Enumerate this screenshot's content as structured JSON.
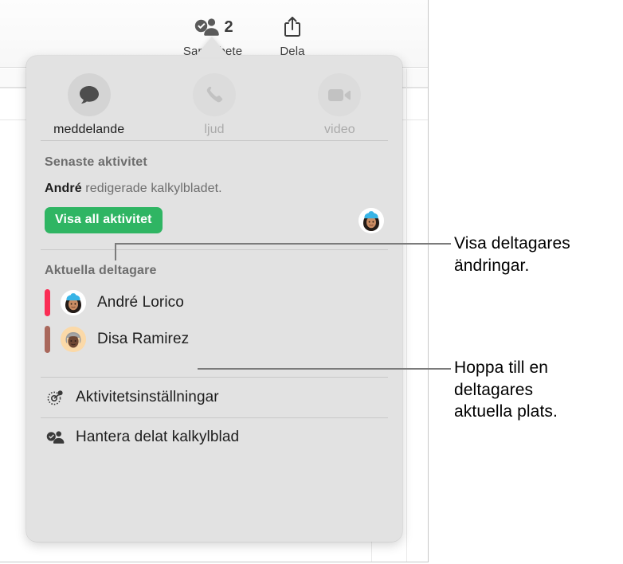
{
  "window": {
    "toolbar": {
      "items": [
        {
          "label": "Samarbete",
          "icon": "collaborate-person-check-icon",
          "badge": "2"
        },
        {
          "label": "Dela",
          "icon": "share-export-icon",
          "badge": ""
        }
      ]
    }
  },
  "popover": {
    "quick_actions": [
      {
        "key": "message",
        "label": "meddelande",
        "icon": "message-bubble-icon",
        "enabled": true
      },
      {
        "key": "audio",
        "label": "ljud",
        "icon": "phone-icon",
        "enabled": false
      },
      {
        "key": "video",
        "label": "video",
        "icon": "video-camera-icon",
        "enabled": false
      }
    ],
    "recent_activity": {
      "title": "Senaste aktivitet",
      "actor": "André",
      "message": " redigerade kalkylbladet.",
      "button_label": "Visa all aktivitet",
      "button_color": "#2fb563",
      "avatar_name": "andre-avatar"
    },
    "participants": {
      "title": "Aktuella deltagare",
      "items": [
        {
          "name": "André Lorico",
          "color": "#fb2d55",
          "avatar": "andre-avatar"
        },
        {
          "name": "Disa Ramirez",
          "color": "#a9685c",
          "avatar": "disa-avatar"
        }
      ]
    },
    "menu": [
      {
        "label": "Aktivitetsinställningar",
        "icon": "activity-settings-gear-icon"
      },
      {
        "label": "Hantera delat kalkylblad",
        "icon": "manage-shared-person-check-icon"
      }
    ]
  },
  "callouts": [
    {
      "id": "callout-changes",
      "lines": [
        "Visa deltagares",
        "ändringar."
      ]
    },
    {
      "id": "callout-jump",
      "lines": [
        "Hoppa till en",
        "deltagares",
        "aktuella plats."
      ]
    }
  ]
}
